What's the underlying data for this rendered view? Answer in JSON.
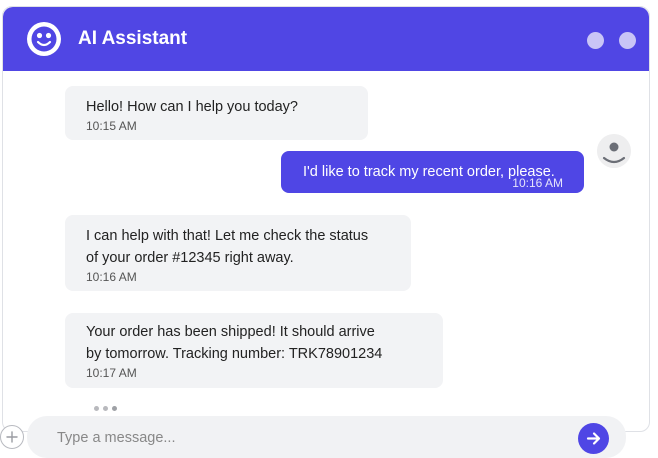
{
  "header": {
    "title": "AI Assistant",
    "bot_icon": "robot-face-icon",
    "window_controls": [
      "minimize-dot",
      "close-dot"
    ],
    "accent_color": "#5046e4"
  },
  "messages": [
    {
      "sender": "assistant",
      "text": "Hello! How can I help you today?",
      "time": "10:15 AM"
    },
    {
      "sender": "user",
      "text": "I'd like to track my recent order, please.",
      "time": "10:16 AM"
    },
    {
      "sender": "assistant",
      "text_lines": [
        "I can help with that! Let me check the status",
        "of your order #12345 right away."
      ],
      "time": "10:16 AM"
    },
    {
      "sender": "assistant",
      "text_lines": [
        "Your order has been shipped! It should arrive",
        "by tomorrow. Tracking number: TRK78901234"
      ],
      "time": "10:17 AM"
    }
  ],
  "typing_indicator": {
    "visible": true,
    "dots": 3
  },
  "composer": {
    "placeholder": "Type a message...",
    "value": "",
    "send_icon": "arrow-right-icon",
    "attach_icon": "plus-icon"
  }
}
